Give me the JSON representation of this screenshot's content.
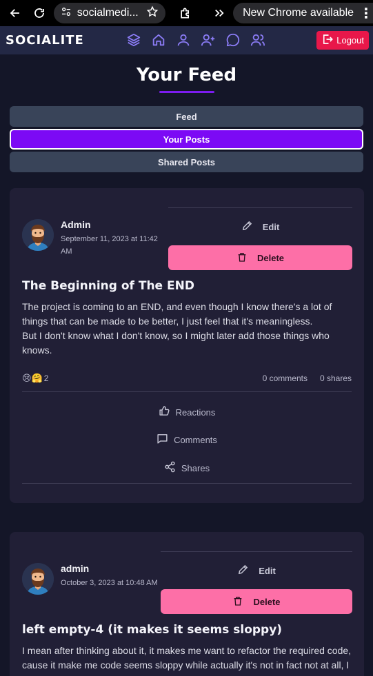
{
  "browser": {
    "url": "socialmedi...",
    "update_label": "New Chrome available"
  },
  "app": {
    "brand": "SOCIALITE",
    "logout_label": "Logout"
  },
  "feed": {
    "title": "Your Feed",
    "tabs": [
      {
        "label": "Feed",
        "active": false
      },
      {
        "label": "Your Posts",
        "active": true
      },
      {
        "label": "Shared Posts",
        "active": false
      }
    ]
  },
  "posts": [
    {
      "author": "Admin",
      "date": "September 11, 2023 at 11:42 AM",
      "edit_label": "Edit",
      "delete_label": "Delete",
      "title": "The Beginning of The END",
      "body_lines": [
        "The project is coming to an END, and even though I know there's a lot of things that can be made to be better, I just feel that it's meaningless.",
        "But I don't know what I don't know, so I might later add those things who knows."
      ],
      "reactions_emoji": "😢🤗",
      "reactions_count": "2",
      "comments": "0 comments",
      "shares": "0 shares",
      "action_reactions": "Reactions",
      "action_comments": "Comments",
      "action_shares": "Shares"
    },
    {
      "author": "admin",
      "date": "October 3, 2023 at 10:48 AM",
      "edit_label": "Edit",
      "delete_label": "Delete",
      "title": "left empty-4 (it makes it seems sloppy)",
      "body_lines": [
        "I mean after thinking about it, it makes me want to refactor the required code, cause it make me code seems sloppy while actually it's not in fact not at all, I"
      ]
    }
  ],
  "colors": {
    "accent": "#7c0af5",
    "delete": "#fd6fa7",
    "logout": "#e8174a",
    "nav_icon": "#8b7cf6"
  }
}
